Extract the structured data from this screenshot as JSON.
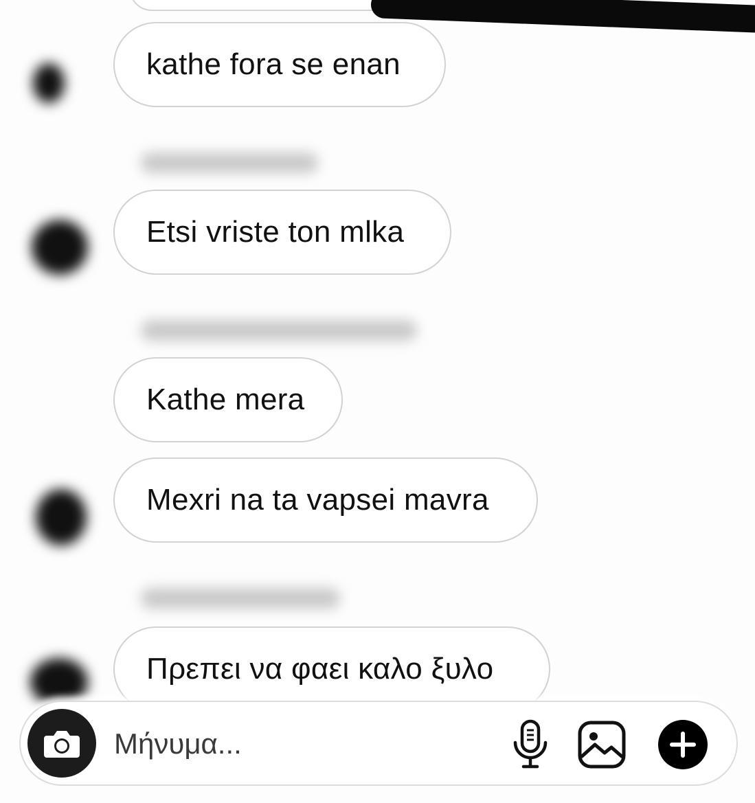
{
  "messages": [
    {
      "text": "kathe fora se enan"
    },
    {
      "text": "Etsi vriste ton mlka"
    },
    {
      "text": "Kathe mera"
    },
    {
      "text": "Mexri na ta vapsei mavra"
    },
    {
      "text": "Πρεπει να φαει καλο ξυλο"
    }
  ],
  "composer": {
    "placeholder": "Μήνυμα..."
  },
  "icons": {
    "camera": "camera-icon",
    "microphone": "microphone-icon",
    "gallery": "gallery-icon",
    "add": "plus-icon"
  },
  "colors": {
    "bubble_border": "#d2d2d2",
    "text": "#111111",
    "camera_button": "#1c1c1c",
    "plus_button": "#000000"
  }
}
